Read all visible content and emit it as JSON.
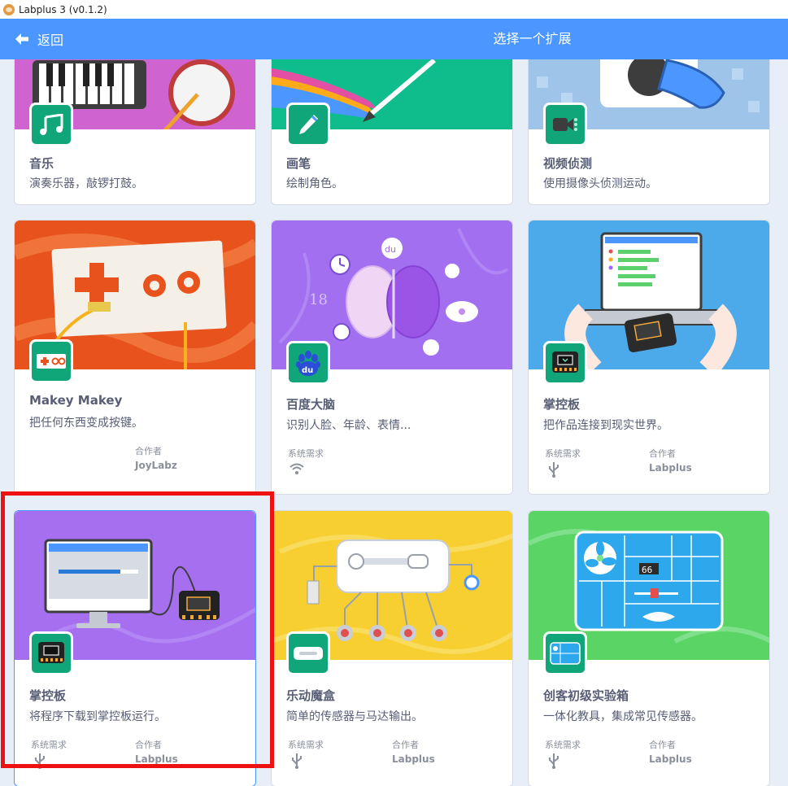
{
  "window": {
    "title": "Labplus 3 (v0.1.2)"
  },
  "header": {
    "back_label": "返回",
    "title": "选择一个扩展"
  },
  "colors": {
    "header": "#4c97ff",
    "badge_green": "#11a67a",
    "selection": "#ee1111"
  },
  "meta_labels": {
    "requirements": "系统需求",
    "author": "合作者"
  },
  "cards": [
    {
      "name": "音乐",
      "desc": "演奏乐器，敲锣打鼓。",
      "icon": "music-notes-icon"
    },
    {
      "name": "画笔",
      "desc": "绘制角色。",
      "icon": "pen-icon"
    },
    {
      "name": "视频侦测",
      "desc": "使用摄像头侦测运动。",
      "icon": "video-camera-icon"
    },
    {
      "name": "Makey Makey",
      "desc": "把任何东西变成按键。",
      "author": "JoyLabz",
      "icon": "makey-board-icon"
    },
    {
      "name": "百度大脑",
      "desc": "识别人脸、年龄、表情...",
      "requirement": "wifi",
      "icon": "baidu-paw-icon"
    },
    {
      "name": "掌控板",
      "desc": "把作品连接到现实世界。",
      "requirement": "usb",
      "author": "Labplus",
      "icon": "controller-board-icon"
    },
    {
      "name": "掌控板",
      "desc": "将程序下载到掌控板运行。",
      "requirement": "usb",
      "author": "Labplus",
      "icon": "controller-board-icon"
    },
    {
      "name": "乐动魔盒",
      "desc": "简单的传感器与马达输出。",
      "requirement": "usb",
      "author": "Labplus",
      "icon": "music-box-icon"
    },
    {
      "name": "创客初级实验箱",
      "desc": "一体化教具，集成常见传感器。",
      "requirement": "usb",
      "author": "Labplus",
      "icon": "maker-kit-icon"
    }
  ]
}
